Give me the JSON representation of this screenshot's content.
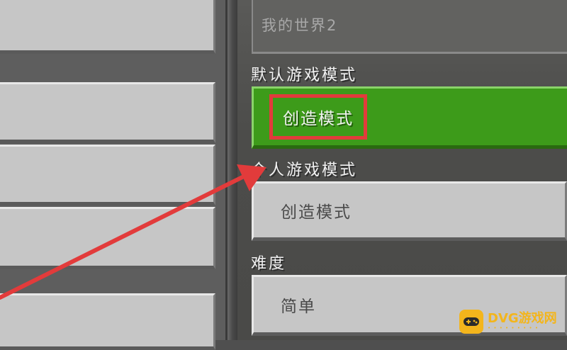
{
  "world": {
    "name": "我的世界2"
  },
  "settings": {
    "default_mode_label": "默认游戏模式",
    "default_mode_value": "创造模式",
    "personal_mode_label": "个人游戏模式",
    "personal_mode_value": "创造模式",
    "difficulty_label": "难度",
    "difficulty_value": "简单"
  },
  "watermark": {
    "text": "DVG游戏网"
  },
  "colors": {
    "selected_green": "#3d9b1a",
    "highlight_red": "#e23b3b",
    "button_gray": "#c6c6c6",
    "watermark_yellow": "#f3b51c"
  }
}
